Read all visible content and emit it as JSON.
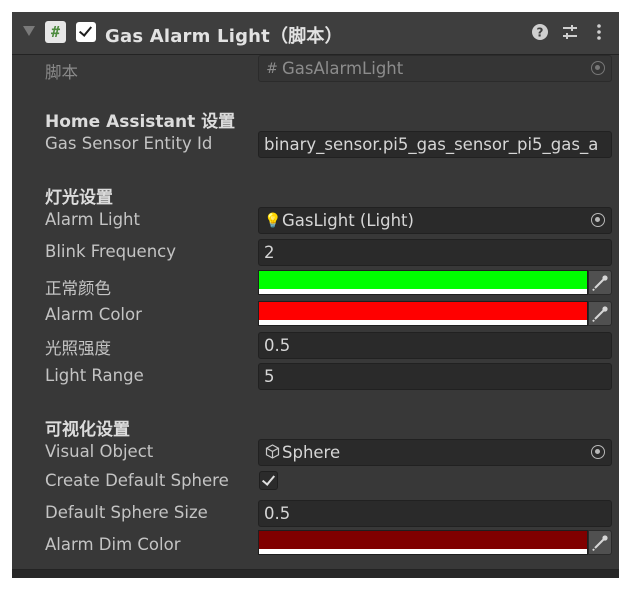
{
  "header": {
    "title": "Gas Alarm Light（脚本）",
    "enabled": true,
    "badge": "#",
    "icons": [
      "help-icon",
      "presets-icon",
      "more-icon"
    ],
    "help_glyph": "?",
    "presets_glyph": "⇄",
    "more_glyph": "⋮"
  },
  "script_row": {
    "label": "脚本",
    "value": "GasAlarmLight",
    "icon": "#"
  },
  "sections": {
    "home_assistant": "Home Assistant 设置",
    "light": "灯光设置",
    "visual": "可视化设置"
  },
  "fields": {
    "gas_sensor_entity_id": {
      "label": "Gas Sensor Entity Id",
      "value": "binary_sensor.pi5_gas_sensor_pi5_gas_a"
    },
    "alarm_light": {
      "label": "Alarm Light",
      "value": "GasLight (Light)",
      "icon": "💡"
    },
    "blink_frequency": {
      "label": "Blink Frequency",
      "value": "2"
    },
    "normal_color": {
      "label": "正常颜色",
      "color": "#00ff00"
    },
    "alarm_color": {
      "label": "Alarm Color",
      "color": "#ff0000"
    },
    "light_intensity": {
      "label": "光照强度",
      "value": "0.5"
    },
    "light_range": {
      "label": "Light Range",
      "value": "5"
    },
    "visual_object": {
      "label": "Visual Object",
      "value": "Sphere",
      "icon": "⬡"
    },
    "create_default_sphere": {
      "label": "Create Default Sphere",
      "checked": true
    },
    "default_sphere_size": {
      "label": "Default Sphere Size",
      "value": "0.5"
    },
    "alarm_dim_color": {
      "label": "Alarm Dim Color",
      "color": "#800000"
    }
  }
}
